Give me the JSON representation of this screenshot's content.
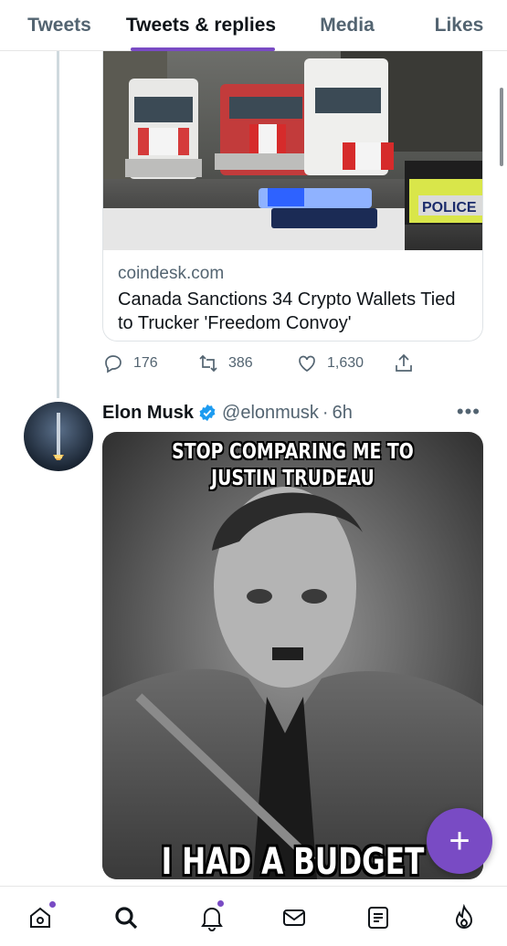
{
  "tabs": [
    {
      "label": "Tweets",
      "active": false
    },
    {
      "label": "Tweets & replies",
      "active": true
    },
    {
      "label": "Media",
      "active": false
    },
    {
      "label": "Likes",
      "active": false
    }
  ],
  "accent_color": "#794bc4",
  "link_card": {
    "image_icon": "trucker-convoy-photo",
    "image_text": "POLICE",
    "domain": "coindesk.com",
    "title": "Canada Sanctions 34 Crypto Wallets Tied to Trucker 'Freedom Convoy'"
  },
  "actions": {
    "reply_count": "176",
    "retweet_count": "386",
    "like_count": "1,630"
  },
  "tweet": {
    "author_name": "Elon Musk",
    "handle": "@elonmusk",
    "separator": "·",
    "time": "6h",
    "more_label": "•••",
    "meme_top_text": "STOP COMPARING ME TO JUSTIN TRUDEAU",
    "meme_bottom_text": "I HAD A BUDGET"
  },
  "fab_label": "+",
  "bottom_nav": [
    "home-icon",
    "search-icon",
    "notifications-icon",
    "messages-icon",
    "lists-icon",
    "spaces-icon"
  ]
}
